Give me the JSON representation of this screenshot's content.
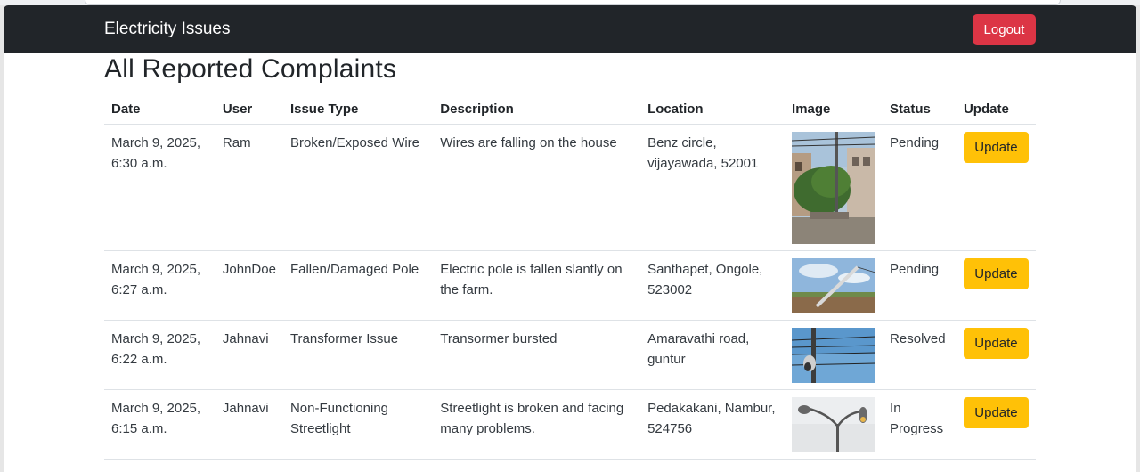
{
  "navbar": {
    "brand": "Electricity Issues",
    "logout_label": "Logout"
  },
  "page": {
    "title": "All Reported Complaints"
  },
  "table": {
    "headers": [
      "Date",
      "User",
      "Issue Type",
      "Description",
      "Location",
      "Image",
      "Status",
      "Update"
    ],
    "update_label": "Update",
    "rows": [
      {
        "date": "March 9, 2025, 6:30 a.m.",
        "user": "Ram",
        "issue_type": "Broken/Exposed Wire",
        "description": "Wires are falling on the house",
        "location": "Benz circle, vijayawada, 52001",
        "status": "Pending",
        "image": "street-pole-tree-photo"
      },
      {
        "date": "March 9, 2025, 6:27 a.m.",
        "user": "JohnDoe",
        "issue_type": "Fallen/Damaged Pole",
        "description": "Electric pole is fallen slantly on the farm.",
        "location": "Santhapet, Ongole, 523002",
        "status": "Pending",
        "image": "fallen-pole-field-photo"
      },
      {
        "date": "March 9, 2025, 6:22 a.m.",
        "user": "Jahnavi",
        "issue_type": "Transformer Issue",
        "description": "Transormer bursted",
        "location": "Amaravathi road, guntur",
        "status": "Resolved",
        "image": "wires-sky-photo"
      },
      {
        "date": "March 9, 2025, 6:15 a.m.",
        "user": "Jahnavi",
        "issue_type": "Non-Functioning Streetlight",
        "description": "Streetlight is broken and facing many problems.",
        "location": "Pedakakani, Nambur, 524756",
        "status": "In Progress",
        "image": "streetlight-photo"
      }
    ]
  }
}
